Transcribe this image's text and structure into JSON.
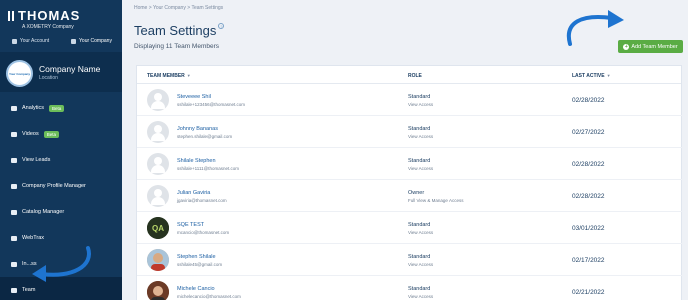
{
  "brand": {
    "name": "THOMAS",
    "sub": "A XOMETRY Company"
  },
  "account_switch": {
    "your_account": "Your Account",
    "your_company": "Your Company"
  },
  "company": {
    "name": "Company Name",
    "location": "Location",
    "logo_text": "Your Company"
  },
  "nav": [
    {
      "label": "Analytics",
      "badge": "Beta",
      "icon": "chart-icon"
    },
    {
      "label": "Videos",
      "badge": "Beta",
      "icon": "video-icon"
    },
    {
      "label": "View Leads",
      "badge": "",
      "icon": "user-icon"
    },
    {
      "label": "Company Profile Manager",
      "badge": "",
      "icon": "building-icon"
    },
    {
      "label": "Catalog Manager",
      "badge": "",
      "icon": "gear-icon"
    },
    {
      "label": "WebTrax",
      "badge": "",
      "icon": "webtrax-icon"
    },
    {
      "label": "In...ss",
      "badge": "",
      "icon": "inbox-icon"
    },
    {
      "label": "Team",
      "badge": "",
      "icon": "team-icon"
    }
  ],
  "breadcrumb": "Home  >  Your Company  >  Team Settings",
  "page": {
    "title": "Team Settings",
    "subtitle": "Displaying 11 Team Members",
    "add_button": "Add Team Member"
  },
  "table": {
    "columns": {
      "member": "TEAM MEMBER",
      "role": "ROLE",
      "last_active": "LAST ACTIVE"
    },
    "rows": [
      {
        "name": "Steveeee Shil",
        "email": "sshilale+123456@thomasnet.com",
        "role": "Standard",
        "access": "View Access",
        "date": "02/28/2022",
        "avatar": "placeholder"
      },
      {
        "name": "Johnny Bananas",
        "email": "stephen.shilale@gmail.com",
        "role": "Standard",
        "access": "View Access",
        "date": "02/27/2022",
        "avatar": "placeholder"
      },
      {
        "name": "Shilale Stephen",
        "email": "sshilale+1111@thomasnet.com",
        "role": "Standard",
        "access": "View Access",
        "date": "02/28/2022",
        "avatar": "placeholder"
      },
      {
        "name": "Julian Gaviria",
        "email": "jgaviria@thomasnet.com",
        "role": "Owner",
        "access": "Full View & Manage Access",
        "date": "02/28/2022",
        "avatar": "placeholder"
      },
      {
        "name": "SQE TEST",
        "email": "mcancio@thomasnet.com",
        "role": "Standard",
        "access": "View Access",
        "date": "03/01/2022",
        "avatar": "photo-sqe"
      },
      {
        "name": "Stephen Shilale",
        "email": "sshilale45@gmail.com",
        "role": "Standard",
        "access": "View Access",
        "date": "02/17/2022",
        "avatar": "photo-person"
      },
      {
        "name": "Michele Cancio",
        "email": "michelecancio@thomasnet.com",
        "role": "Standard",
        "access": "View Access",
        "date": "02/21/2022",
        "avatar": "photo-person-2"
      }
    ]
  },
  "colors": {
    "sidebar": "#12375b",
    "accent_green": "#5aac44",
    "link_blue": "#1c5fa3",
    "arrow_blue": "#1e74d0"
  }
}
